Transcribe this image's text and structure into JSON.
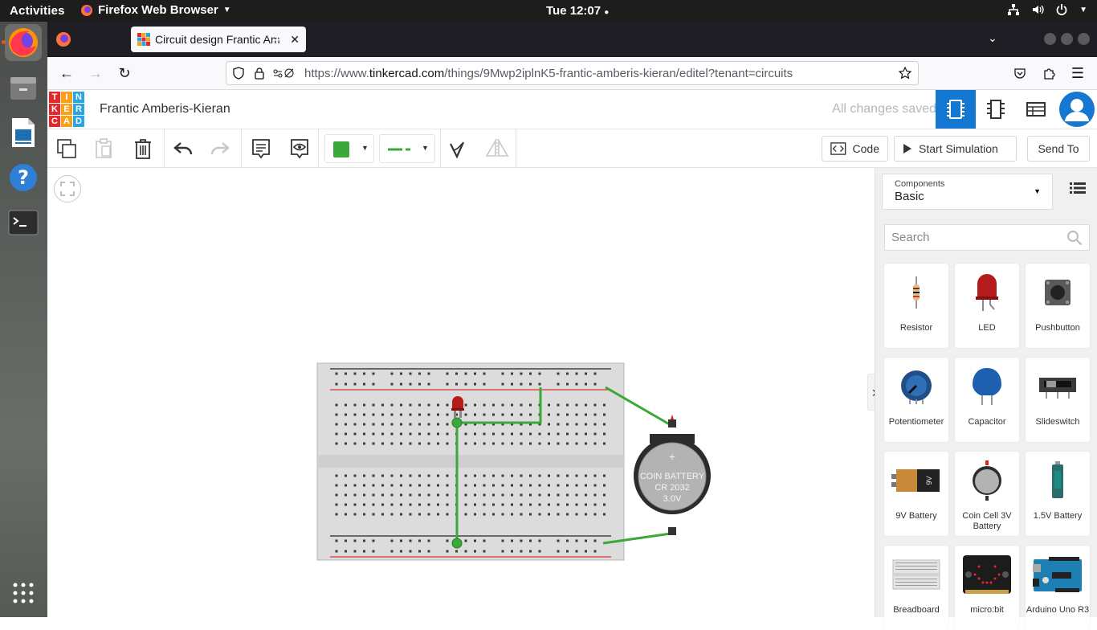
{
  "system": {
    "activities": "Activities",
    "app_name": "Firefox Web Browser",
    "clock": "Tue 12:07"
  },
  "browser": {
    "tab_title": "Circuit design Frantic Am",
    "url_prefix": "https://www.",
    "url_domain": "tinkercad.com",
    "url_path": "/things/9Mwp2iplnK5-frantic-amberis-kieran/editel?tenant=circuits"
  },
  "app": {
    "logo_letters": [
      "T",
      "I",
      "N",
      "K",
      "E",
      "R",
      "C",
      "A",
      "D"
    ],
    "logo_colors": [
      "#e2282c",
      "#f8a21b",
      "#27a6e1",
      "#e2282c",
      "#f8a21b",
      "#27a6e1",
      "#e2282c",
      "#f8a21b",
      "#27a6e1"
    ],
    "design_title": "Frantic Amberis-Kieran",
    "save_status": "All changes saved",
    "accent_color": "#1477d1"
  },
  "toolbar": {
    "code_label": "Code",
    "simulate_label": "Start Simulation",
    "send_label": "Send To",
    "fill_color": "#3aa93a"
  },
  "battery": {
    "line1": "COIN BATTERY",
    "line2": "CR 2032",
    "line3": "3.0V"
  },
  "panel": {
    "components_label": "Components",
    "components_value": "Basic",
    "search_placeholder": "Search",
    "items": [
      {
        "name": "Resistor"
      },
      {
        "name": "LED"
      },
      {
        "name": "Pushbutton"
      },
      {
        "name": "Potentiometer"
      },
      {
        "name": "Capacitor"
      },
      {
        "name": "Slideswitch"
      },
      {
        "name": "9V Battery"
      },
      {
        "name": "Coin Cell 3V Battery"
      },
      {
        "name": "1.5V Battery"
      },
      {
        "name": "Breadboard"
      },
      {
        "name": "micro:bit"
      },
      {
        "name": "Arduino Uno R3"
      }
    ]
  }
}
